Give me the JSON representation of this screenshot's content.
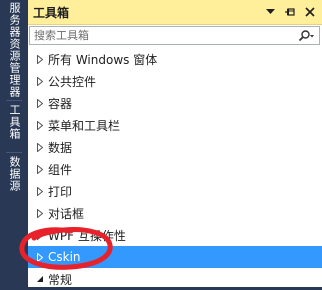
{
  "side_tabs": [
    "服务器资源管理器",
    "工具箱",
    "数据源"
  ],
  "panel": {
    "title": "工具箱",
    "controls": {
      "dropdown": "▾",
      "pin": "⊸",
      "close": "✕"
    },
    "search": {
      "placeholder": "搜索工具箱",
      "button_icon": "search-icon"
    }
  },
  "groups": [
    {
      "label": "所有 Windows 窗体",
      "state": "collapsed"
    },
    {
      "label": "公共控件",
      "state": "collapsed"
    },
    {
      "label": "容器",
      "state": "collapsed"
    },
    {
      "label": "菜单和工具栏",
      "state": "collapsed"
    },
    {
      "label": "数据",
      "state": "collapsed"
    },
    {
      "label": "组件",
      "state": "collapsed"
    },
    {
      "label": "打印",
      "state": "collapsed"
    },
    {
      "label": "对话框",
      "state": "collapsed"
    },
    {
      "label": "WPF 互操作性",
      "state": "collapsed"
    },
    {
      "label": "Cskin",
      "state": "selected"
    },
    {
      "label": "常规",
      "state": "expanded"
    }
  ],
  "colors": {
    "side_strip": "#293955",
    "title_bar": "#ffef9a",
    "selection": "#3399ff",
    "annotation": "#e8222a"
  }
}
